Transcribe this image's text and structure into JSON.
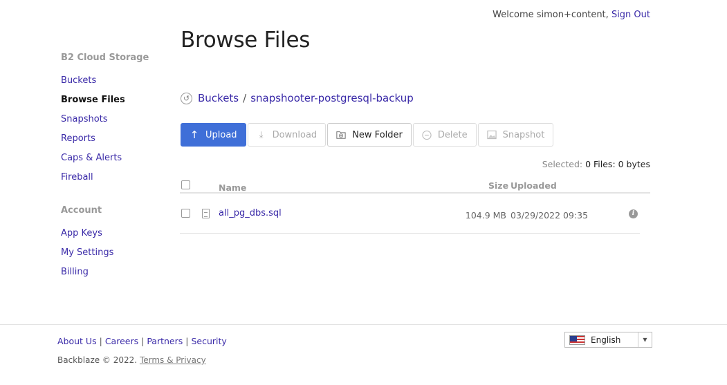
{
  "header": {
    "welcome_text": "Welcome simon+content,",
    "sign_out": "Sign Out"
  },
  "sidebar": {
    "section1_title": "B2 Cloud Storage",
    "section1_items": [
      "Buckets",
      "Browse Files",
      "Snapshots",
      "Reports",
      "Caps & Alerts",
      "Fireball"
    ],
    "active_item": "Browse Files",
    "section2_title": "Account",
    "section2_items": [
      "App Keys",
      "My Settings",
      "Billing"
    ]
  },
  "main": {
    "title": "Browse Files",
    "breadcrumb": {
      "root": "Buckets",
      "separator": "/",
      "current": "snapshooter-postgresql-backup"
    },
    "toolbar": {
      "upload": "Upload",
      "download": "Download",
      "new_folder": "New Folder",
      "delete": "Delete",
      "snapshot": "Snapshot"
    },
    "selection": {
      "label": "Selected:",
      "value": "0 Files: 0 bytes"
    },
    "table": {
      "columns": {
        "name": "Name",
        "size": "Size",
        "uploaded": "Uploaded"
      },
      "rows": [
        {
          "name": "all_pg_dbs.sql",
          "size": "104.9 MB",
          "uploaded": "03/29/2022 09:35"
        }
      ]
    }
  },
  "footer": {
    "links": [
      "About Us",
      "Careers",
      "Partners",
      "Security"
    ],
    "copyright": "Backblaze © 2022.",
    "terms": "Terms & Privacy",
    "language": "English"
  },
  "icons": {
    "upload": "arrow-up-icon",
    "download": "download-icon",
    "new_folder": "folder-plus-icon",
    "delete": "minus-circle-icon",
    "snapshot": "image-icon",
    "info": "info-icon"
  },
  "colors": {
    "primary": "#3f6fd8",
    "link": "#3a2aa8"
  }
}
